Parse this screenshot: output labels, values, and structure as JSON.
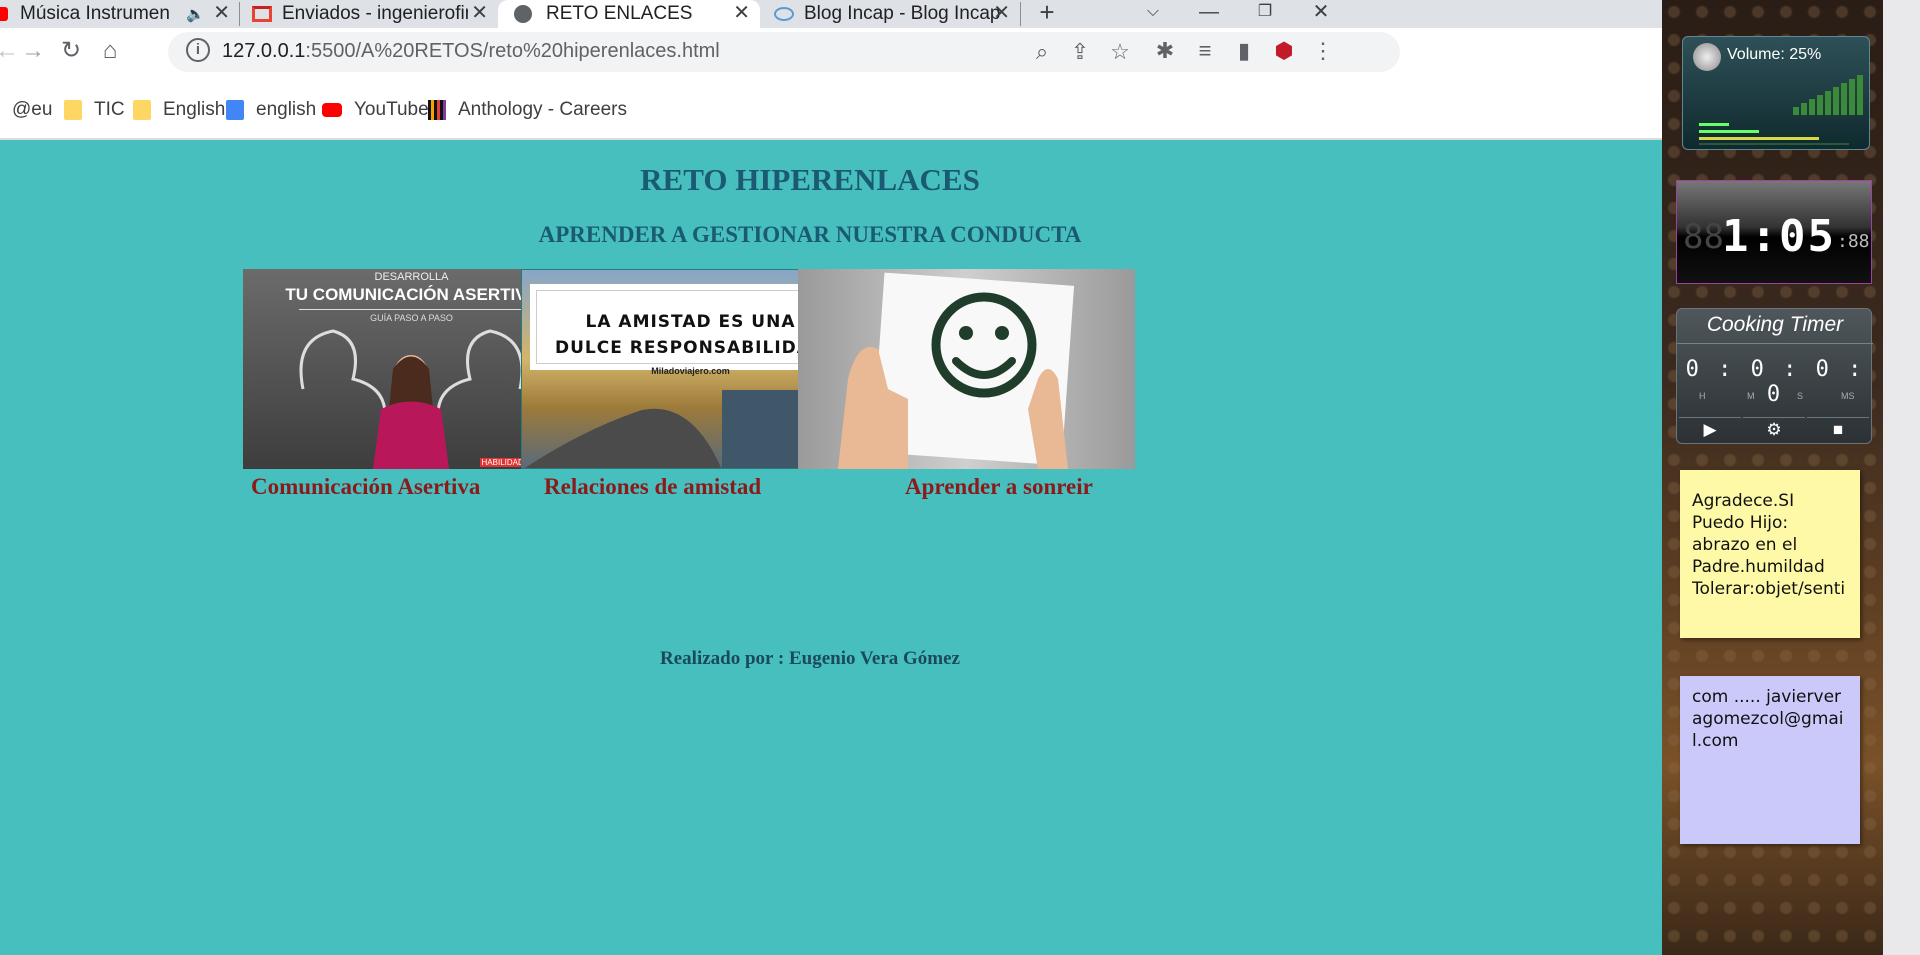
{
  "tabs": [
    {
      "title": "Música Instrumental Cri",
      "icon": "youtube-icon"
    },
    {
      "title": "Enviados - ingenierofinancie",
      "icon": "gmail-icon"
    },
    {
      "title": "RETO ENLACES",
      "icon": "globe-icon"
    },
    {
      "title": "Blog Incap - Blog Incap",
      "icon": "incap-icon"
    }
  ],
  "toolbar": {
    "url_host": "127.0.0.1",
    "url_path": ":5500/A%20RETOS/reto%20hiperenlaces.html"
  },
  "bookmarks": [
    {
      "label": "@eu",
      "icon": "none"
    },
    {
      "label": "TIC",
      "icon": "folder-icon"
    },
    {
      "label": "English",
      "icon": "folder-icon"
    },
    {
      "label": "english",
      "icon": "translate-icon"
    },
    {
      "label": "YouTube",
      "icon": "youtube-icon"
    },
    {
      "label": "Anthology - Careers",
      "icon": "anthology-icon"
    }
  ],
  "page": {
    "title": "RETO HIPERENLACES",
    "subtitle": "APRENDER A GESTIONAR NUESTRA CONDUCTA",
    "cards": [
      {
        "link": "Comunicación Asertiva",
        "img_line1": "DESARROLLA",
        "img_line2": "TU COMUNICACIÓN ASERTIVA",
        "img_line3": "GUÍA PASO A PASO",
        "img_footer": "HABILIDADSOCIAL.COM"
      },
      {
        "link": "Relaciones de amistad",
        "img_line1": "LA AMISTAD ES UNA",
        "img_line2": "DULCE RESPONSABILIDAD",
        "img_line3": "Miladoviajero.com"
      },
      {
        "link": "Aprender a sonreir"
      }
    ],
    "credit": "Realizado por : Eugenio Vera Gómez"
  },
  "gadgets": {
    "volume_label": "Volume: 25%",
    "clock_time": "1:05",
    "timer_title": "Cooking Timer",
    "timer_value": "0 : 0 : 0 : 0",
    "timer_units": [
      "H",
      "M",
      "S",
      "MS"
    ],
    "note_yellow": "Agradece.SI Puedo Hijo: abrazo en el Padre.humildad Tolerar:objet/senti",
    "note_blue": "com ..... javierveragomezcol@gmail.com"
  },
  "colors": {
    "page_bg": "#48bfbf",
    "title": "#1a5a73",
    "link": "#8b1a1a"
  }
}
